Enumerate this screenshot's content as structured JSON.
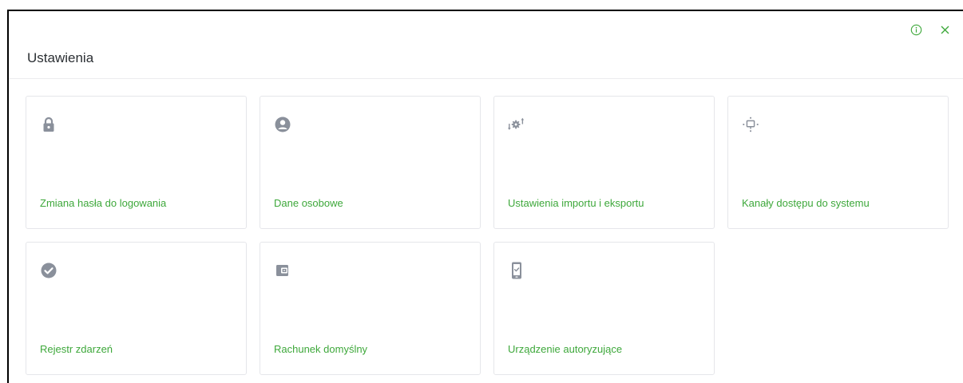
{
  "window": {
    "title": "Ustawienia",
    "info_icon": "info-circle-icon",
    "close_icon": "close-icon"
  },
  "colors": {
    "accent": "#3ea83b",
    "icon_gray": "#8a909b",
    "border": "#e5e6ea"
  },
  "tiles": [
    {
      "label": "Zmiana hasła do logowania",
      "icon": "lock-icon"
    },
    {
      "label": "Dane osobowe",
      "icon": "user-circle-icon"
    },
    {
      "label": "Ustawienia importu i eksportu",
      "icon": "gear-arrows-icon"
    },
    {
      "label": "Kanały dostępu do systemu",
      "icon": "access-channels-icon"
    },
    {
      "label": "Rejestr zdarzeń",
      "icon": "check-circle-icon"
    },
    {
      "label": "Rachunek domyślny",
      "icon": "wallet-icon"
    },
    {
      "label": "Urządzenie autoryzujące",
      "icon": "phone-check-icon"
    }
  ]
}
